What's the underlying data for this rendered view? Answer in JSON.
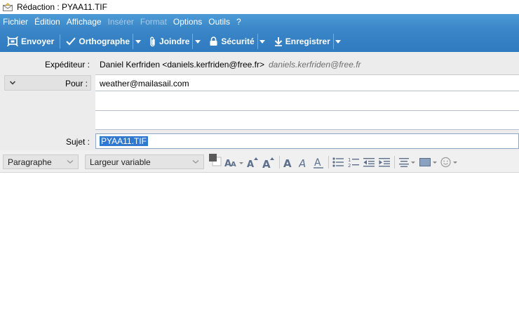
{
  "window": {
    "title": "Rédaction : PYAA11.TIF"
  },
  "menubar": {
    "items": [
      {
        "label": "Fichier",
        "disabled": false
      },
      {
        "label": "Édition",
        "disabled": false
      },
      {
        "label": "Affichage",
        "disabled": false
      },
      {
        "label": "Insérer",
        "disabled": true
      },
      {
        "label": "Format",
        "disabled": true
      },
      {
        "label": "Options",
        "disabled": false
      },
      {
        "label": "Outils",
        "disabled": false
      },
      {
        "label": "?",
        "disabled": false
      }
    ]
  },
  "toolbar": {
    "send_label": "Envoyer",
    "spelling_label": "Orthographe",
    "attach_label": "Joindre",
    "security_label": "Sécurité",
    "save_label": "Enregistrer"
  },
  "header": {
    "sender_label": "Expéditeur :",
    "sender_value": "Daniel Kerfriden <daniels.kerfriden@free.fr>",
    "sender_alias": "daniels.kerfriden@free.fr",
    "recipient_type": "Pour :",
    "recipient_value": "weather@mailasail.com",
    "subject_label": "Sujet :",
    "subject_value": "PYAA11.TIF"
  },
  "format_toolbar": {
    "paragraph_style": "Paragraphe",
    "font_family": "Largeur variable"
  },
  "colors": {
    "toolbar_blue": "#3a86c8",
    "selection_blue": "#3079d0",
    "header_gray": "#ececec"
  }
}
